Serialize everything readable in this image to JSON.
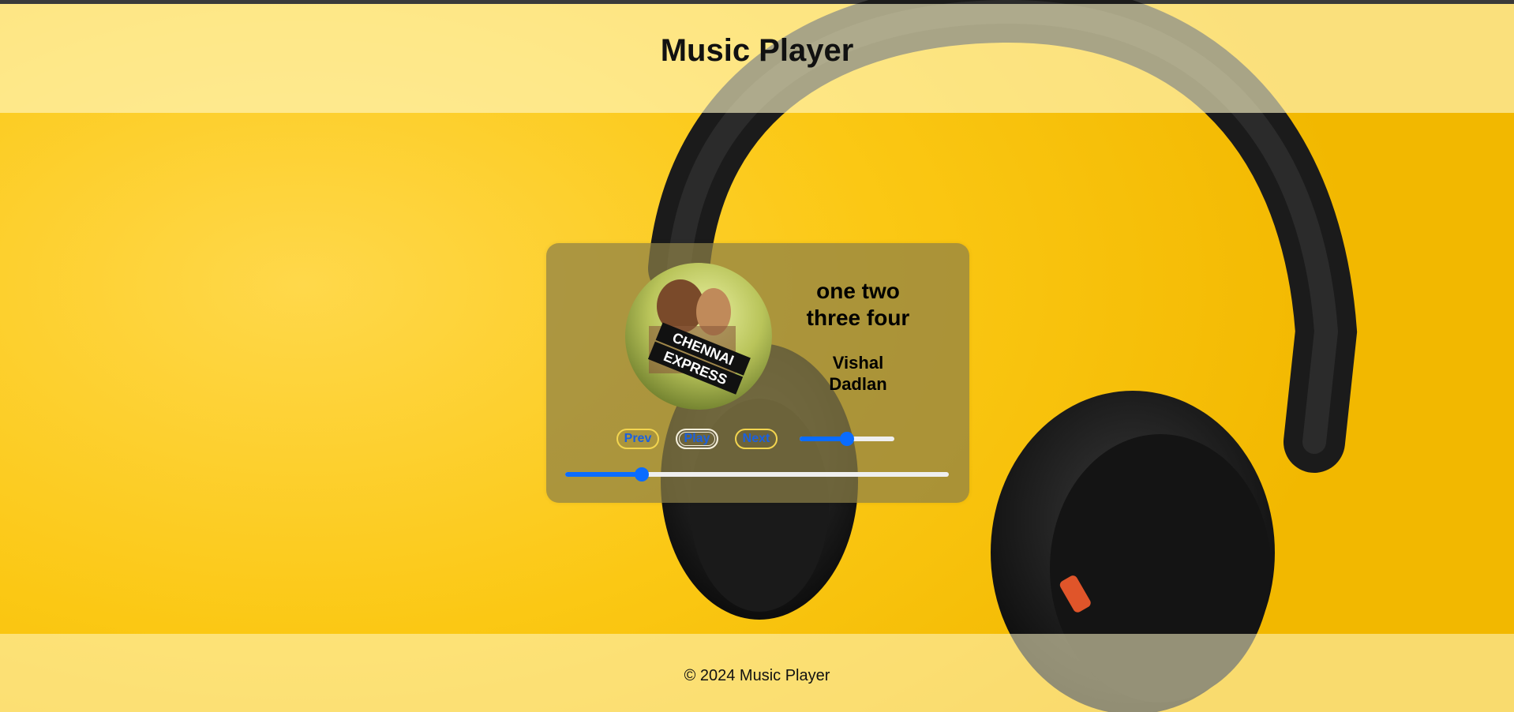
{
  "header": {
    "title": "Music Player"
  },
  "track": {
    "title": "one two three four",
    "artist": "Vishal Dadlan"
  },
  "cover": {
    "art_text_line1": "CHENNAI",
    "art_text_line2": "EXPRESS"
  },
  "controls": {
    "prev_label": "Prev",
    "play_label": "Play",
    "next_label": "Next",
    "volume_level": 0.5,
    "progress_level": 0.2
  },
  "footer": {
    "copyright": "© 2024 Music Player"
  },
  "colors": {
    "background": "#f6c200",
    "accent": "#0a6cff",
    "button_border": "#f3d54f"
  }
}
